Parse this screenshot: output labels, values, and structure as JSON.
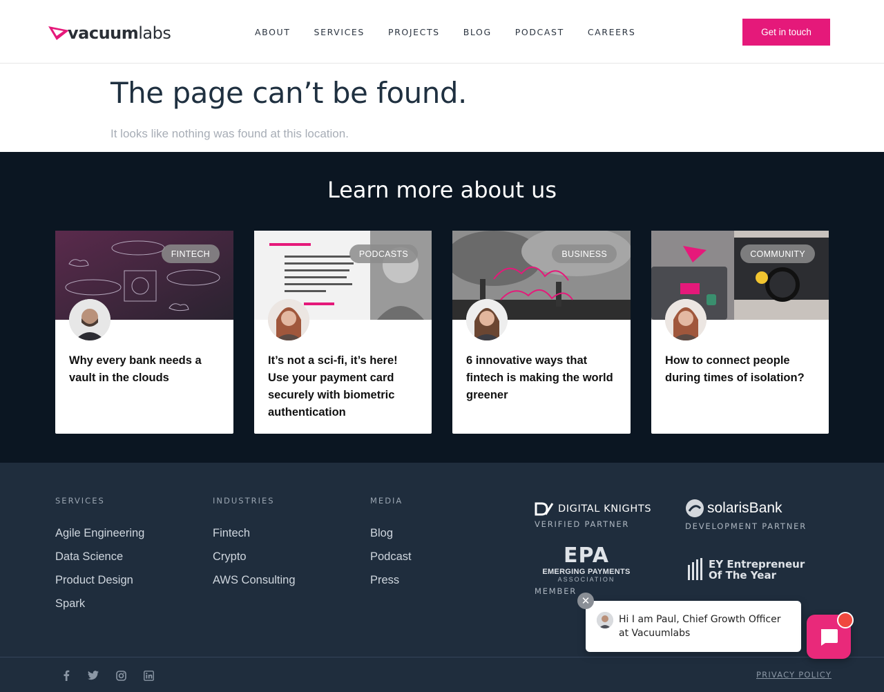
{
  "header": {
    "logo_bold": "vacuum",
    "logo_light": "labs",
    "nav": [
      "ABOUT",
      "SERVICES",
      "PROJECTS",
      "BLOG",
      "PODCAST",
      "CAREERS"
    ],
    "cta_label": "Get in touch"
  },
  "notfound": {
    "title": "The page can’t be found.",
    "subtitle": "It looks like nothing was found at this location."
  },
  "learn": {
    "title": "Learn more about us",
    "cards": [
      {
        "tag": "FINTECH",
        "title": "Why every bank needs a vault in the clouds"
      },
      {
        "tag": "PODCASTS",
        "title": "It’s not a sci-fi, it’s here! Use your payment card securely with biometric authentication"
      },
      {
        "tag": "BUSINESS",
        "title": "6 innovative ways that fintech is making the world greener"
      },
      {
        "tag": "COMMUNITY",
        "title": "How to connect people during times of isolation?"
      }
    ]
  },
  "footer": {
    "services": {
      "heading": "SERVICES",
      "items": [
        "Agile Engineering",
        "Data Science",
        "Product Design",
        "Spark"
      ]
    },
    "industries": {
      "heading": "INDUSTRIES",
      "items": [
        "Fintech",
        "Crypto",
        "AWS Consulting"
      ]
    },
    "media": {
      "heading": "MEDIA",
      "items": [
        "Blog",
        "Podcast",
        "Press"
      ]
    },
    "partners": {
      "digital_knights": {
        "name": "DIGITAL KNIGHTS",
        "sub": "VERIFIED PARTNER"
      },
      "solaris": {
        "name": "solarisBank",
        "sub": "DEVELOPMENT PARTNER"
      },
      "epa": {
        "name": "EPA",
        "line": "EMERGING PAYMENTS",
        "line2": "ASSOCIATION",
        "sub": "MEMBER"
      },
      "ey": {
        "line1": "EY Entrepreneur",
        "line2": "Of The Year"
      }
    },
    "privacy": "PRIVACY POLICY"
  },
  "chat": {
    "message": "Hi I am Paul, Chief Growth Officer at Vacuumlabs"
  },
  "colors": {
    "brand_pink": "#e5197a",
    "dark_section": "#0b1622",
    "footer_bg": "#1f2d3d"
  }
}
